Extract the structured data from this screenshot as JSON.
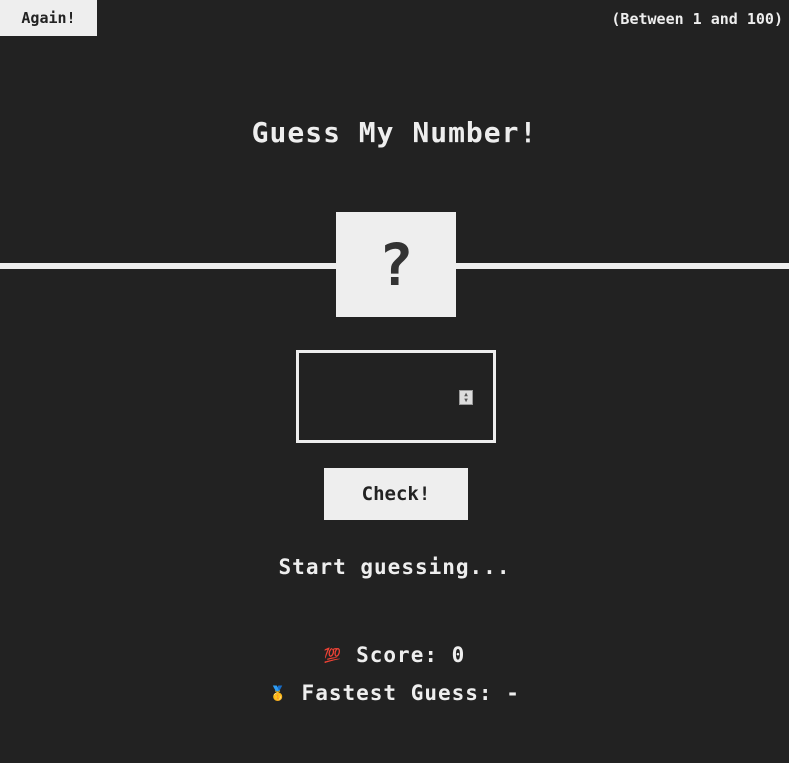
{
  "header": {
    "again_label": "Again!",
    "range_text": "(Between 1 and 100)"
  },
  "title": "Guess My Number!",
  "secret_display": "?",
  "guess_input": {
    "value": "",
    "placeholder": ""
  },
  "check_label": "Check!",
  "message": "Start guessing...",
  "score": {
    "icon": "💯",
    "label": "Score:",
    "value": "0"
  },
  "fastest": {
    "icon": "🥇",
    "label": "Fastest Guess:",
    "value": "-"
  },
  "colors": {
    "background": "#222222",
    "foreground": "#eeeeee",
    "box_text": "#333333"
  }
}
